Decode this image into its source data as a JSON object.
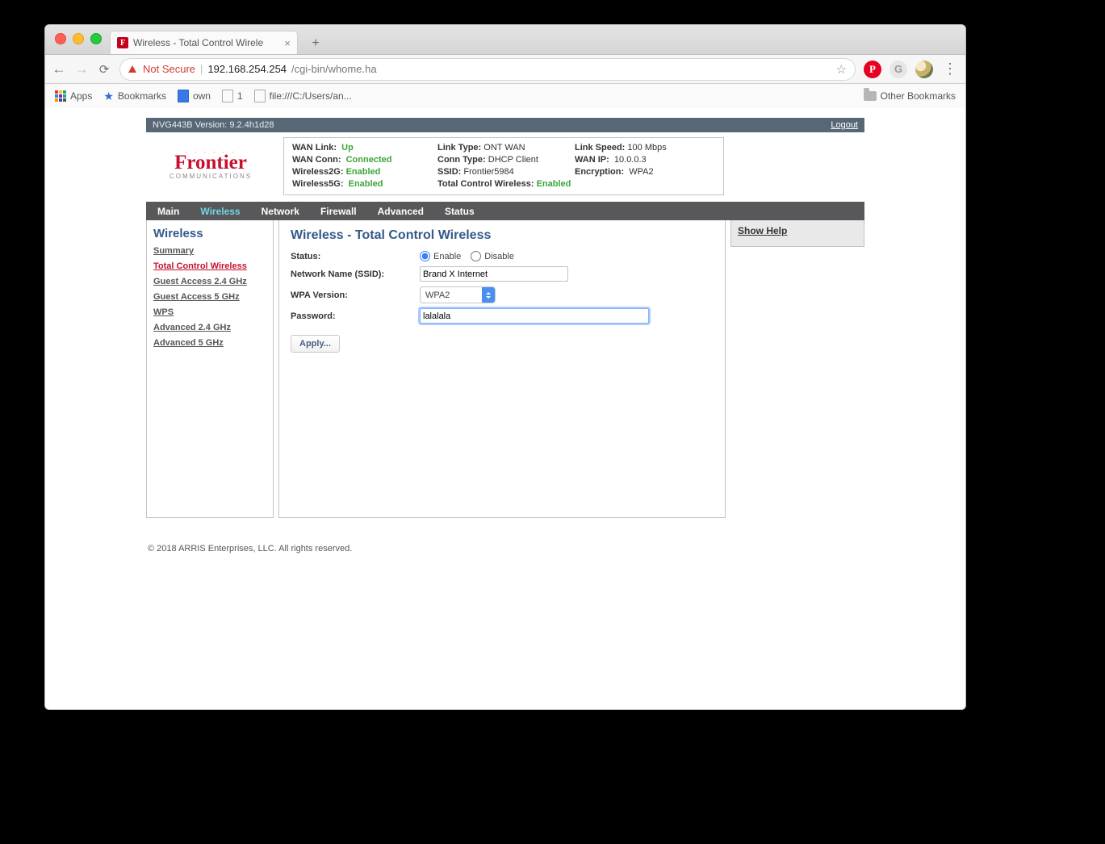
{
  "browser": {
    "tab_title": "Wireless - Total Control Wirele",
    "favicon_letter": "F",
    "not_secure": "Not Secure",
    "host": "192.168.254.254",
    "path": "/cgi-bin/whome.ha"
  },
  "bookmarks": {
    "apps": "Apps",
    "bookmarks": "Bookmarks",
    "own": "own",
    "one": "1",
    "file": "file:///C:/Users/an...",
    "other": "Other Bookmarks"
  },
  "router": {
    "version_label": "NVG443B Version: 9.2.4h1d28",
    "logout": "Logout",
    "logo": {
      "main": "Frontier",
      "sub": "COMMUNICATIONS"
    },
    "status": {
      "wan_link_lbl": "WAN Link:",
      "wan_link_val": "Up",
      "wan_conn_lbl": "WAN Conn:",
      "wan_conn_val": "Connected",
      "w2g_lbl": "Wireless2G:",
      "w2g_val": "Enabled",
      "w5g_lbl": "Wireless5G:",
      "w5g_val": "Enabled",
      "link_type_lbl": "Link Type:",
      "link_type_val": "ONT WAN",
      "conn_type_lbl": "Conn Type:",
      "conn_type_val": "DHCP Client",
      "ssid_lbl": "SSID:",
      "ssid_val": "Frontier5984",
      "tcw_lbl": "Total Control Wireless:",
      "tcw_val": "Enabled",
      "speed_lbl": "Link Speed:",
      "speed_val": "100 Mbps",
      "wanip_lbl": "WAN IP:",
      "wanip_val": "10.0.0.3",
      "enc_lbl": "Encryption:",
      "enc_val": "WPA2"
    },
    "nav": [
      "Main",
      "Wireless",
      "Network",
      "Firewall",
      "Advanced",
      "Status"
    ],
    "nav_active_index": 1,
    "sidebar": {
      "title": "Wireless",
      "items": [
        "Summary",
        "Total Control Wireless",
        "Guest Access 2.4 GHz",
        "Guest Access 5 GHz",
        "WPS",
        "Advanced 2.4 GHz",
        "Advanced 5 GHz"
      ],
      "active_index": 1
    },
    "form": {
      "title": "Wireless - Total Control Wireless",
      "status_label": "Status:",
      "enable_label": "Enable",
      "disable_label": "Disable",
      "ssid_label": "Network Name (SSID):",
      "ssid_value": "Brand X Internet",
      "wpa_label": "WPA Version:",
      "wpa_value": "WPA2",
      "pwd_label": "Password:",
      "pwd_value": "lalalala",
      "apply_label": "Apply..."
    },
    "help_link": "Show Help",
    "footer": "© 2018 ARRIS Enterprises, LLC. All rights reserved."
  }
}
